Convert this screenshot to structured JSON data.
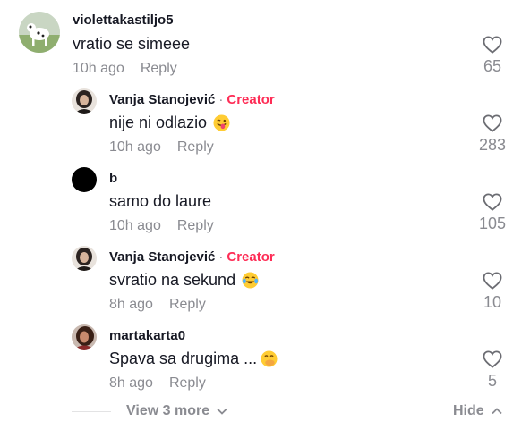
{
  "comments": [
    {
      "username": "violettakastiljo5",
      "creator": false,
      "text": "vratio se simeee",
      "emoji": "",
      "time": "10h ago",
      "reply": "Reply",
      "likes": "65"
    },
    {
      "username": "Vanja Stanojević",
      "creator": true,
      "creator_label": "Creator",
      "text": "nije ni odlazio",
      "emoji": "winking-tongue-face",
      "time": "10h ago",
      "reply": "Reply",
      "likes": "283"
    },
    {
      "username": "b",
      "creator": false,
      "text": "samo do laure",
      "emoji": "",
      "time": "10h ago",
      "reply": "Reply",
      "likes": "105"
    },
    {
      "username": "Vanja Stanojević",
      "creator": true,
      "creator_label": "Creator",
      "text": "svratio na sekund",
      "emoji": "tears-of-joy-face",
      "time": "8h ago",
      "reply": "Reply",
      "likes": "10"
    },
    {
      "username": "martakarta0",
      "creator": false,
      "text": "Spava sa drugima ...",
      "emoji": "hand-over-mouth-face",
      "time": "8h ago",
      "reply": "Reply",
      "likes": "5"
    }
  ],
  "footer": {
    "view_more": "View 3 more",
    "hide": "Hide"
  },
  "colors": {
    "creator": "#fe2c55",
    "muted": "#8a8b91",
    "text": "#161823"
  }
}
